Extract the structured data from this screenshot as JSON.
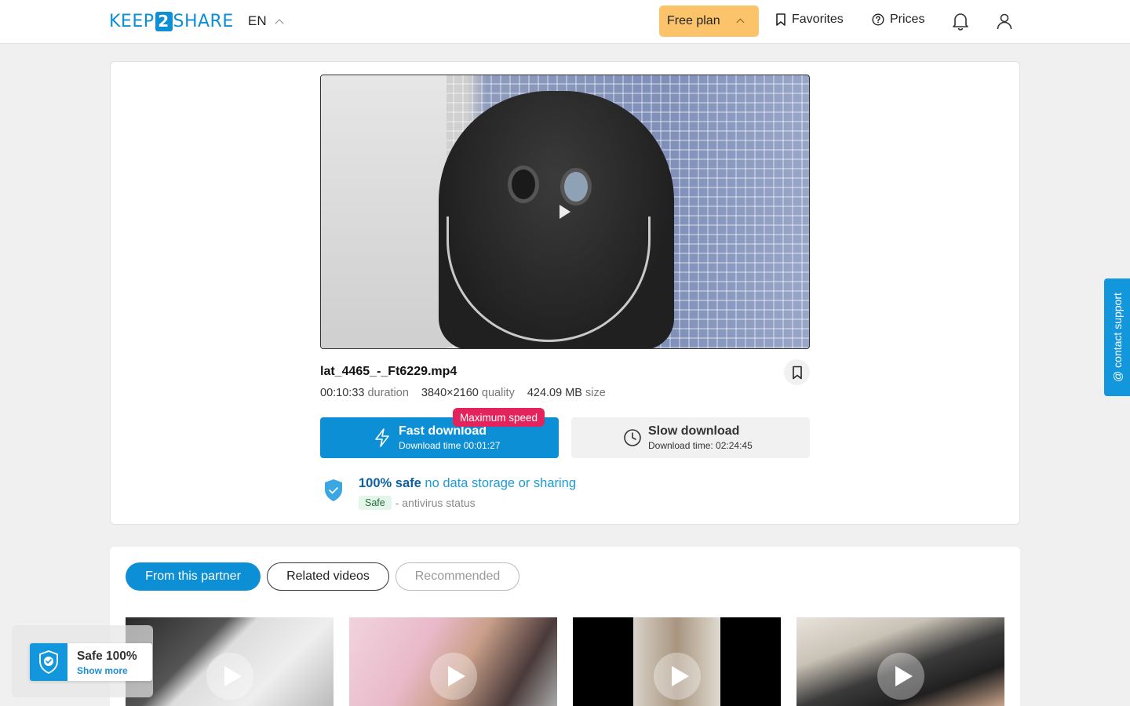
{
  "header": {
    "logo_left": "KEEP",
    "logo_mid": "2",
    "logo_right": "SHARE",
    "language": "EN",
    "plan_label": "Free plan",
    "favorites_label": "Favorites",
    "prices_label": "Prices",
    "icons": [
      "chevron-up-icon",
      "bookmark-icon",
      "question-circle-icon",
      "bell-icon",
      "user-icon"
    ]
  },
  "file": {
    "name": "lat_4465_-_Ft6229.mp4",
    "duration": "00:10:33",
    "duration_label": "duration",
    "quality": "3840×2160",
    "quality_label": "quality",
    "size": "424.09 MB",
    "size_label": "size"
  },
  "download": {
    "fast_title": "Fast download",
    "fast_sub": "Download time 00:01:27",
    "fast_badge": "Maximum speed",
    "slow_title": "Slow download",
    "slow_sub": "Download time: 02:24:45"
  },
  "safety": {
    "strong": "100% safe",
    "light": "no data storage or sharing",
    "badge": "Safe",
    "status": "- antivirus status"
  },
  "tabs": [
    {
      "label": "From this partner",
      "state": "active"
    },
    {
      "label": "Related videos",
      "state": "outline"
    },
    {
      "label": "Recommended",
      "state": "muted"
    }
  ],
  "support_label": "@ contact support",
  "safe_widget": {
    "title": "Safe 100%",
    "link": "Show more"
  },
  "colors": {
    "accent": "#0d8fd6",
    "plan": "#fbc46b",
    "badge_red": "#e3245c"
  }
}
